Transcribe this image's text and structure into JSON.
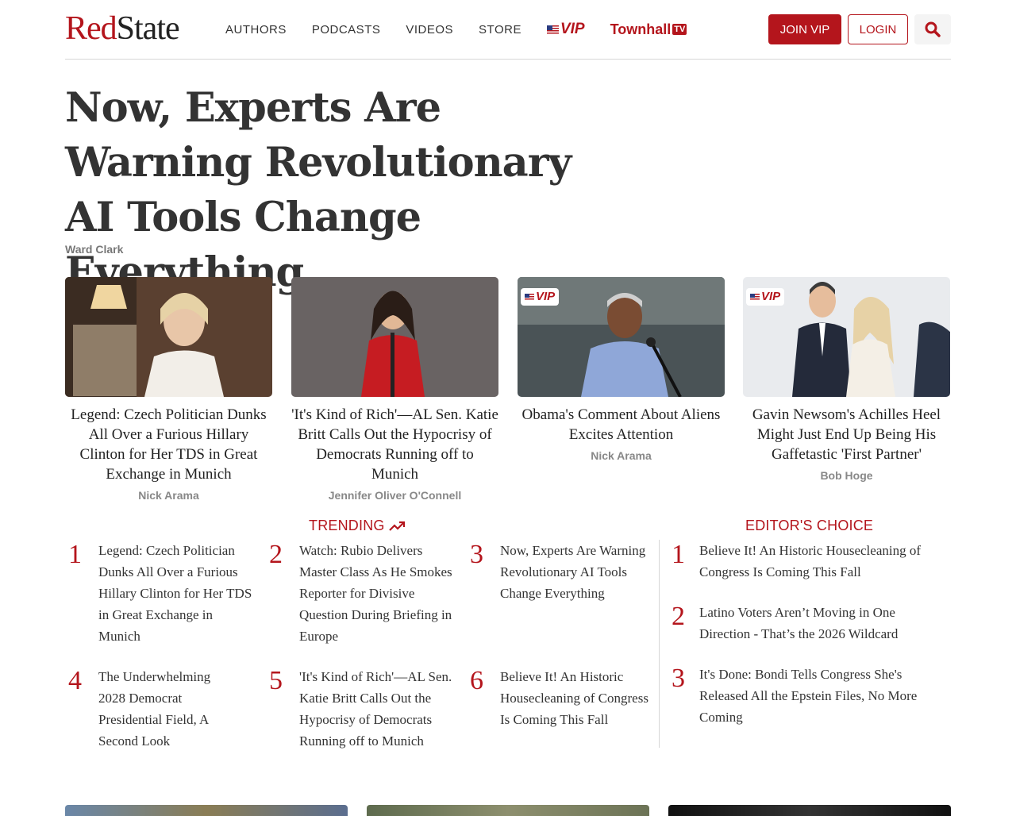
{
  "brand": {
    "logo_red": "Red",
    "logo_dark": "State"
  },
  "nav": {
    "items": [
      "AUTHORS",
      "PODCASTS",
      "VIDEOS",
      "STORE"
    ],
    "vip": "VIP",
    "townhall": "Townhall",
    "townhall_tv": "TV"
  },
  "buttons": {
    "join": "JOIN VIP",
    "login": "LOGIN"
  },
  "hero": {
    "title": "Now, Experts Are Warning Revolutionary AI Tools Change Everything",
    "author": "Ward Clark"
  },
  "cards": [
    {
      "title": "Legend: Czech Politician Dunks All Over a Furious Hillary Clinton for Her TDS in Great Exchange in Munich",
      "author": "Nick Arama",
      "vip": false
    },
    {
      "title": "'It's Kind of Rich'—AL Sen. Katie Britt Calls Out the Hypocrisy of Democrats Running off to Munich",
      "author": "Jennifer Oliver O'Connell",
      "vip": false
    },
    {
      "title": "Obama's Comment About Aliens Excites Attention",
      "author": "Nick Arama",
      "vip": true
    },
    {
      "title": "Gavin Newsom's Achilles Heel Might Just End Up Being His Gaffetastic 'First Partner'",
      "author": "Bob Hoge",
      "vip": true
    }
  ],
  "vip_badge": "VIP",
  "trending": {
    "title": "TRENDING",
    "items": [
      {
        "num": "1",
        "text": "Legend: Czech Politician Dunks All Over a Furious Hillary Clinton for Her TDS in Great Exchange in Munich"
      },
      {
        "num": "2",
        "text": "Watch: Rubio Delivers Master Class As He Smokes Reporter for Divisive Question During Briefing in Europe"
      },
      {
        "num": "3",
        "text": "Now, Experts Are Warning Revolutionary AI Tools Change Everything"
      },
      {
        "num": "4",
        "text": "The Underwhelming 2028 Democrat Presidential Field, A Second Look"
      },
      {
        "num": "5",
        "text": "'It's Kind of Rich'—AL Sen. Katie Britt Calls Out the Hypocrisy of Democrats Running off to Munich"
      },
      {
        "num": "6",
        "text": "Believe It! An Historic Housecleaning of Congress Is Coming This Fall"
      }
    ]
  },
  "editors_choice": {
    "title": "EDITOR'S CHOICE",
    "items": [
      {
        "num": "1",
        "text": "Believe It! An Historic Housecleaning of Congress Is Coming This Fall"
      },
      {
        "num": "2",
        "text": "Latino Voters Aren’t Moving in One Direction - That’s the 2026 Wildcard"
      },
      {
        "num": "3",
        "text": "It's Done: Bondi Tells Congress She's Released All the Epstein Files, No More Coming"
      }
    ]
  },
  "colors": {
    "brand_red": "#b4151c",
    "text": "#333333",
    "muted": "#888888"
  }
}
